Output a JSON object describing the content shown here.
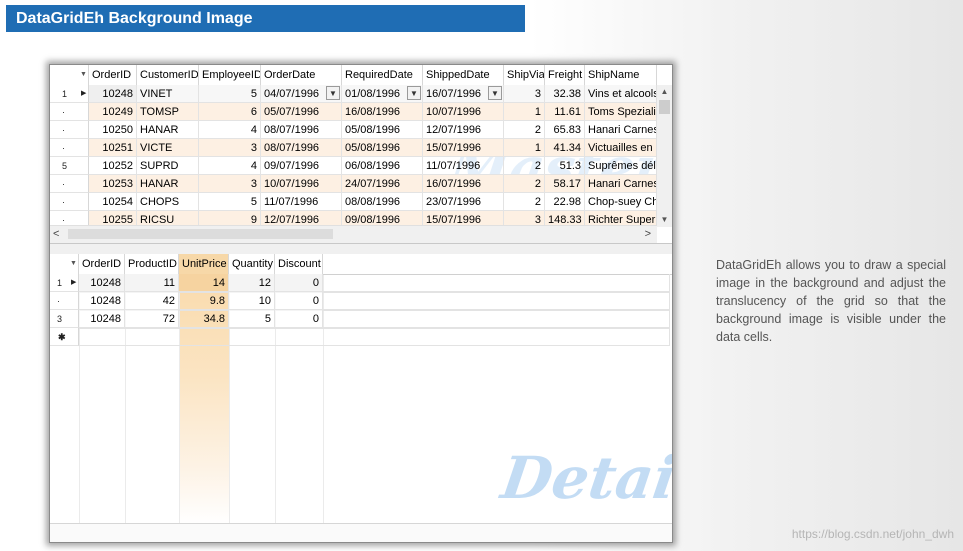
{
  "title": "DataGridEh Background Image",
  "description": "DataGridEh allows you to draw a special image in the background and adjust the translucency of the grid so that the background image is visible under the data cells.",
  "source_url": "https://blog.csdn.net/john_dwh",
  "master": {
    "watermark": "Master",
    "columns": [
      "OrderID",
      "CustomerID",
      "EmployeeID",
      "OrderDate",
      "RequiredDate",
      "ShippedDate",
      "ShipVia",
      "Freight",
      "ShipName"
    ],
    "rows": [
      {
        "ind": "1",
        "OrderID": "10248",
        "CustomerID": "VINET",
        "EmployeeID": "5",
        "OrderDate": "04/07/1996",
        "RequiredDate": "01/08/1996",
        "ShippedDate": "16/07/1996",
        "ShipVia": "3",
        "Freight": "32.38",
        "ShipName": "Vins et alcools"
      },
      {
        "ind": "·",
        "OrderID": "10249",
        "CustomerID": "TOMSP",
        "EmployeeID": "6",
        "OrderDate": "05/07/1996",
        "RequiredDate": "16/08/1996",
        "ShippedDate": "10/07/1996",
        "ShipVia": "1",
        "Freight": "11.61",
        "ShipName": "Toms Speziali"
      },
      {
        "ind": "·",
        "OrderID": "10250",
        "CustomerID": "HANAR",
        "EmployeeID": "4",
        "OrderDate": "08/07/1996",
        "RequiredDate": "05/08/1996",
        "ShippedDate": "12/07/1996",
        "ShipVia": "2",
        "Freight": "65.83",
        "ShipName": "Hanari Carnes"
      },
      {
        "ind": "·",
        "OrderID": "10251",
        "CustomerID": "VICTE",
        "EmployeeID": "3",
        "OrderDate": "08/07/1996",
        "RequiredDate": "05/08/1996",
        "ShippedDate": "15/07/1996",
        "ShipVia": "1",
        "Freight": "41.34",
        "ShipName": "Victuailles en"
      },
      {
        "ind": "5",
        "OrderID": "10252",
        "CustomerID": "SUPRD",
        "EmployeeID": "4",
        "OrderDate": "09/07/1996",
        "RequiredDate": "06/08/1996",
        "ShippedDate": "11/07/1996",
        "ShipVia": "2",
        "Freight": "51.3",
        "ShipName": "Suprêmes dél"
      },
      {
        "ind": "·",
        "OrderID": "10253",
        "CustomerID": "HANAR",
        "EmployeeID": "3",
        "OrderDate": "10/07/1996",
        "RequiredDate": "24/07/1996",
        "ShippedDate": "16/07/1996",
        "ShipVia": "2",
        "Freight": "58.17",
        "ShipName": "Hanari Carnes"
      },
      {
        "ind": "·",
        "OrderID": "10254",
        "CustomerID": "CHOPS",
        "EmployeeID": "5",
        "OrderDate": "11/07/1996",
        "RequiredDate": "08/08/1996",
        "ShippedDate": "23/07/1996",
        "ShipVia": "2",
        "Freight": "22.98",
        "ShipName": "Chop-suey Ch"
      },
      {
        "ind": "·",
        "OrderID": "10255",
        "CustomerID": "RICSU",
        "EmployeeID": "9",
        "OrderDate": "12/07/1996",
        "RequiredDate": "09/08/1996",
        "ShippedDate": "15/07/1996",
        "ShipVia": "3",
        "Freight": "148.33",
        "ShipName": "Richter Super"
      }
    ]
  },
  "detail": {
    "watermark": "Detail",
    "columns": [
      "OrderID",
      "ProductID",
      "UnitPrice",
      "Quantity",
      "Discount"
    ],
    "rows": [
      {
        "ind": "1",
        "OrderID": "10248",
        "ProductID": "11",
        "UnitPrice": "14",
        "Quantity": "12",
        "Discount": "0"
      },
      {
        "ind": "·",
        "OrderID": "10248",
        "ProductID": "42",
        "UnitPrice": "9.8",
        "Quantity": "10",
        "Discount": "0"
      },
      {
        "ind": "3",
        "OrderID": "10248",
        "ProductID": "72",
        "UnitPrice": "34.8",
        "Quantity": "5",
        "Discount": "0"
      }
    ],
    "new_row_marker": "✱"
  }
}
